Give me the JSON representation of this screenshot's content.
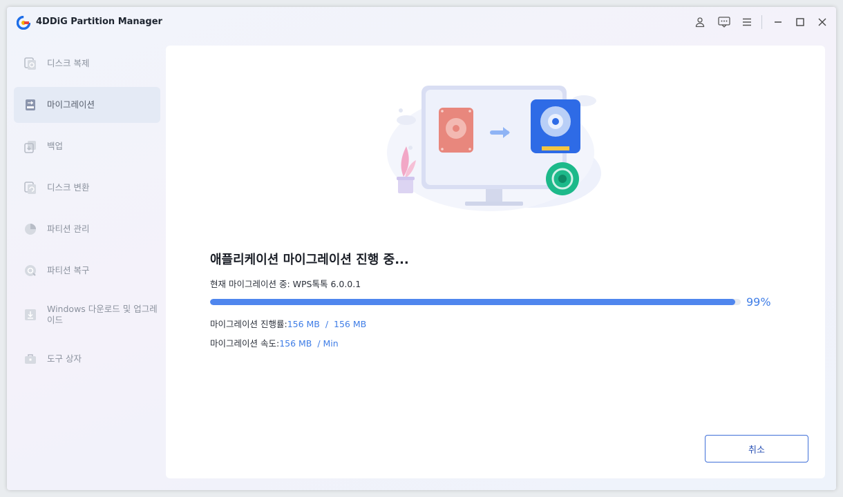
{
  "app": {
    "title": "4DDiG Partition Manager"
  },
  "sidebar": {
    "items": [
      {
        "label": "디스크 복제",
        "icon": "disk-clone-icon"
      },
      {
        "label": "마이그레이션",
        "icon": "migration-icon"
      },
      {
        "label": "백업",
        "icon": "backup-icon"
      },
      {
        "label": "디스크 변환",
        "icon": "disk-convert-icon"
      },
      {
        "label": "파티션 관리",
        "icon": "partition-manage-icon"
      },
      {
        "label": "파티션 복구",
        "icon": "partition-recover-icon"
      },
      {
        "label": "Windows 다운로드 및 업그레이드",
        "icon": "windows-download-icon"
      },
      {
        "label": "도구 상자",
        "icon": "toolbox-icon"
      }
    ],
    "active_index": 1
  },
  "main": {
    "status_title": "애플리케이션 마이그레이션 진행 중...",
    "current_label": "현재 마이그레이션 중: ",
    "current_app": "WPS톡톡 6.0.0.1",
    "progress_percent": 99,
    "progress_text": "99%",
    "progress_label": "마이그레이션 진행률:",
    "progress_value": "156 MB  /  156 MB",
    "speed_label": "마이그레이션 속도:",
    "speed_value": "156 MB  / Min",
    "cancel_label": "취소"
  },
  "colors": {
    "accent": "#3f7de6",
    "progress": "#4f86ee"
  }
}
